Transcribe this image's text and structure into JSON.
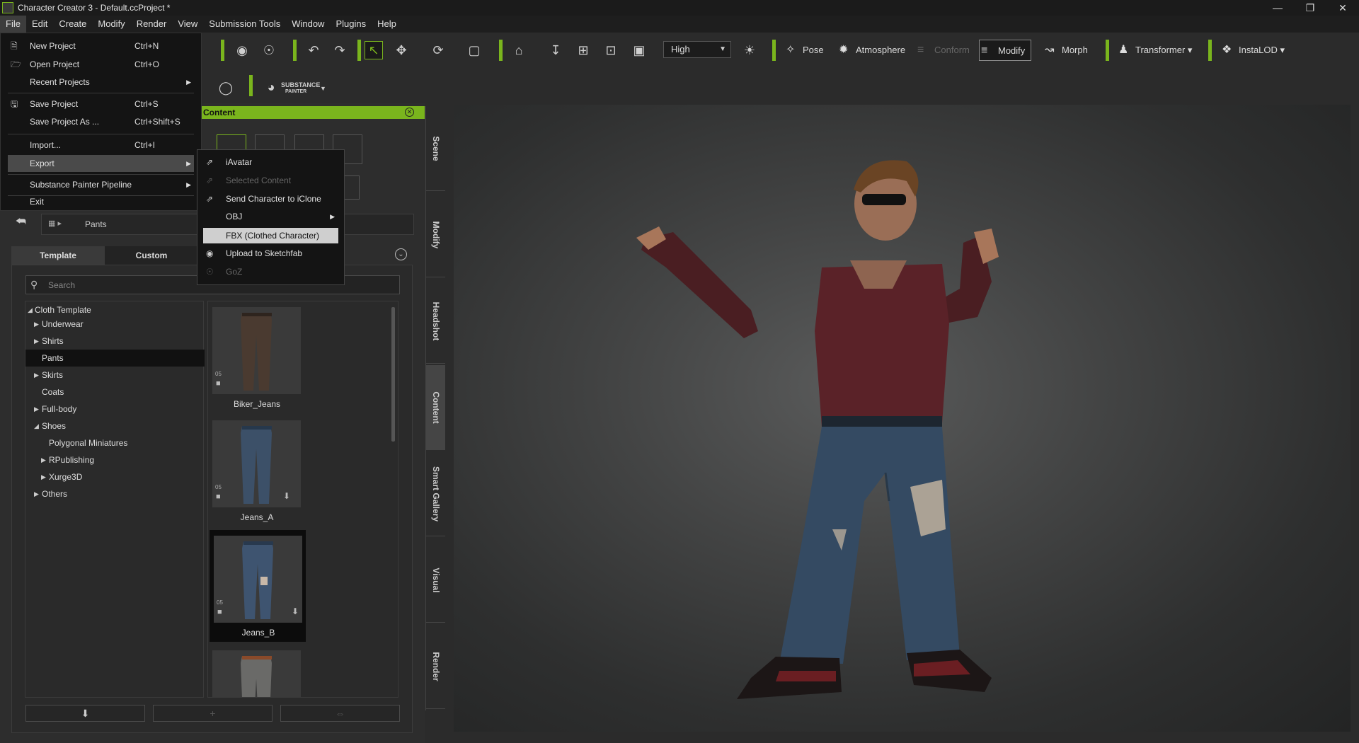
{
  "window": {
    "title": "Character Creator 3 - Default.ccProject *"
  },
  "menubar": [
    "File",
    "Edit",
    "Create",
    "Modify",
    "Render",
    "View",
    "Submission Tools",
    "Window",
    "Plugins",
    "Help"
  ],
  "toolbar": {
    "quality": "High",
    "pose": "Pose",
    "atmosphere": "Atmosphere",
    "conform": "Conform",
    "modify": "Modify",
    "morph": "Morph",
    "transformer": "Transformer",
    "instalod": "InstaLOD",
    "substance_line1": "SUBSTANCE",
    "substance_line2": "PAINTER"
  },
  "file_menu": {
    "items": [
      {
        "label": "New Project",
        "shortcut": "Ctrl+N"
      },
      {
        "label": "Open Project",
        "shortcut": "Ctrl+O"
      },
      {
        "label": "Recent Projects",
        "shortcut": ""
      },
      {
        "label": "Save Project",
        "shortcut": "Ctrl+S"
      },
      {
        "label": "Save Project As ...",
        "shortcut": "Ctrl+Shift+S"
      },
      {
        "label": "Import...",
        "shortcut": "Ctrl+I"
      },
      {
        "label": "Export",
        "shortcut": ""
      },
      {
        "label": "Substance Painter Pipeline",
        "shortcut": ""
      },
      {
        "label": "Exit",
        "shortcut": ""
      }
    ]
  },
  "export_menu": {
    "items": [
      "iAvatar",
      "Selected Content",
      "Send Character to iClone",
      "OBJ",
      "FBX (Clothed Character)",
      "Upload to Sketchfab",
      "GoZ"
    ]
  },
  "panel": {
    "title": "Content",
    "breadcrumb": "Pants",
    "tabs": [
      "Template",
      "Custom"
    ],
    "search_placeholder": "Search",
    "tree": [
      "Cloth Template",
      "Underwear",
      "Shirts",
      "Pants",
      "Skirts",
      "Coats",
      "Full-body",
      "Shoes",
      "Polygonal Miniatures",
      "RPublishing",
      "Xurge3D",
      "Others"
    ],
    "items": [
      {
        "name": "Biker_Jeans",
        "badge": "05"
      },
      {
        "name": "Jeans_A",
        "badge": "05"
      },
      {
        "name": "Jeans_B",
        "badge": "05"
      }
    ]
  },
  "side_tabs": [
    "Scene",
    "Modify",
    "Headshot",
    "Content",
    "Smart Gallery",
    "Visual",
    "Render"
  ]
}
